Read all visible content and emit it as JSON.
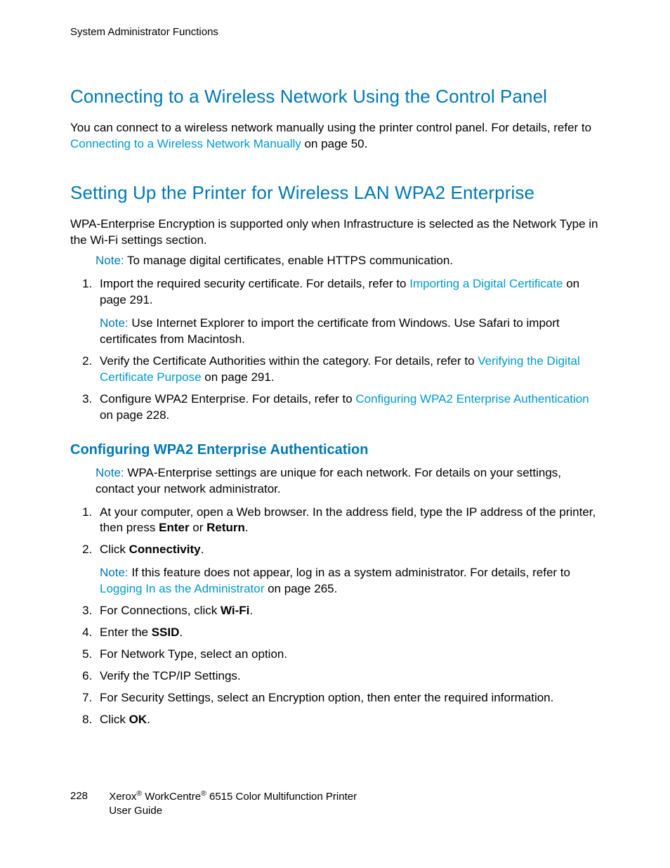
{
  "runningHeader": "System Administrator Functions",
  "section1": {
    "title": "Connecting to a Wireless Network Using the Control Panel",
    "intro_pre": "You can connect to a wireless network manually using the printer control panel. For details, refer to ",
    "intro_link": "Connecting to a Wireless Network Manually",
    "intro_post": " on page 50."
  },
  "section2": {
    "title": "Setting Up the Printer for Wireless LAN WPA2 Enterprise",
    "intro": "WPA-Enterprise Encryption is supported only when Infrastructure is selected as the Network Type in the Wi-Fi settings section.",
    "noteLabel": "Note:",
    "note1": " To manage digital certificates, enable HTTPS communication.",
    "step1_pre": "Import the required security certificate. For details, refer to ",
    "step1_link": "Importing a Digital Certificate",
    "step1_post": " on page 291.",
    "step1_note": " Use Internet Explorer to import the certificate from Windows. Use Safari to import certificates from Macintosh.",
    "step2_pre": "Verify the Certificate Authorities within the category. For details, refer to ",
    "step2_link": "Verifying the Digital Certificate Purpose",
    "step2_post": " on page 291.",
    "step3_pre": "Configure WPA2 Enterprise. For details, refer to ",
    "step3_link": "Configuring WPA2 Enterprise Authentication",
    "step3_post": " on page 228."
  },
  "section3": {
    "title": "Configuring WPA2 Enterprise Authentication",
    "noteLabel": "Note:",
    "note1": " WPA-Enterprise settings are unique for each network. For details on your settings, contact your network administrator.",
    "step1_a": "At your computer, open a Web browser. In the address field, type the IP address of the printer, then press ",
    "step1_b1": "Enter",
    "step1_c": " or ",
    "step1_b2": "Return",
    "step1_d": ".",
    "step2_a": "Click ",
    "step2_b": "Connectivity",
    "step2_c": ".",
    "step2_note_a": " If this feature does not appear, log in as a system administrator. For details, refer to ",
    "step2_note_link": "Logging In as the Administrator",
    "step2_note_b": " on page 265.",
    "step3_a": "For Connections, click ",
    "step3_b": "Wi-Fi",
    "step3_c": ".",
    "step4_a": "Enter the ",
    "step4_b": "SSID",
    "step4_c": ".",
    "step5": "For Network Type, select an option.",
    "step6": "Verify the TCP/IP Settings.",
    "step7": "For Security Settings, select an Encryption option, then enter the required information.",
    "step8_a": "Click ",
    "step8_b": "OK",
    "step8_c": "."
  },
  "footer": {
    "pageNumber": "228",
    "line1_a": "Xerox",
    "line1_b": " WorkCentre",
    "line1_c": " 6515 Color Multifunction Printer",
    "line2": "User Guide"
  }
}
